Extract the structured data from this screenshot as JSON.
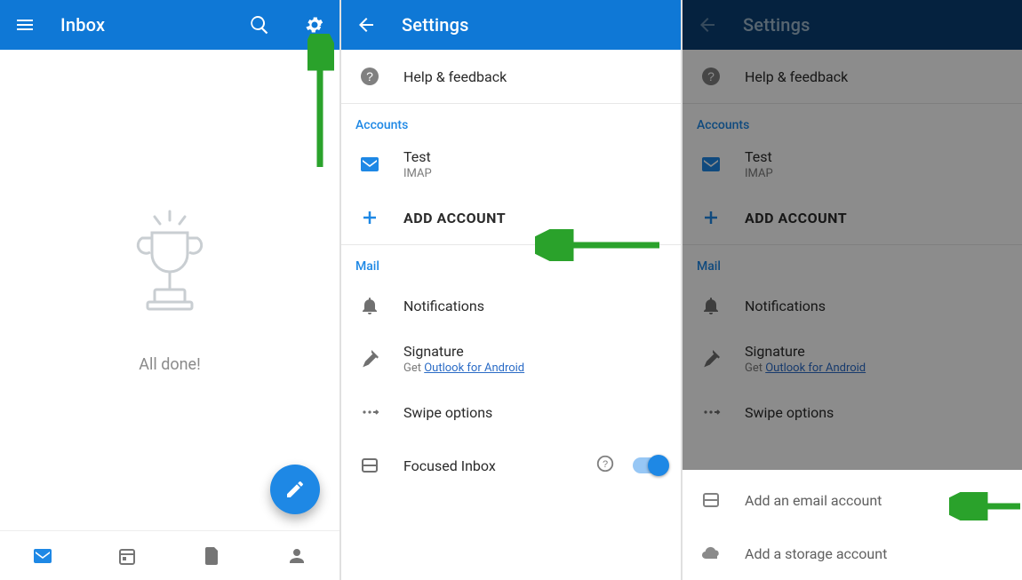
{
  "colors": {
    "blue": "#0f78d6",
    "blue_dark": "#0a3f73",
    "accent": "#1e88e5",
    "arrow": "#2aa22b"
  },
  "panel1": {
    "title": "Inbox",
    "empty_text": "All done!"
  },
  "panel2": {
    "title": "Settings",
    "help_label": "Help & feedback",
    "accounts_section": "Accounts",
    "account_name": "Test",
    "account_type": "IMAP",
    "add_account_label": "ADD ACCOUNT",
    "mail_section": "Mail",
    "notifications_label": "Notifications",
    "signature_label": "Signature",
    "signature_prefix": "Get ",
    "signature_link": "Outlook for Android",
    "swipe_label": "Swipe options",
    "focused_label": "Focused Inbox"
  },
  "panel3": {
    "title": "Settings",
    "help_label": "Help & feedback",
    "accounts_section": "Accounts",
    "account_name": "Test",
    "account_type": "IMAP",
    "add_account_label": "ADD ACCOUNT",
    "mail_section": "Mail",
    "notifications_label": "Notifications",
    "signature_label": "Signature",
    "signature_prefix": "Get ",
    "signature_link": "Outlook for Android",
    "swipe_label": "Swipe options",
    "sheet_add_email": "Add an email account",
    "sheet_add_storage": "Add a storage account"
  }
}
